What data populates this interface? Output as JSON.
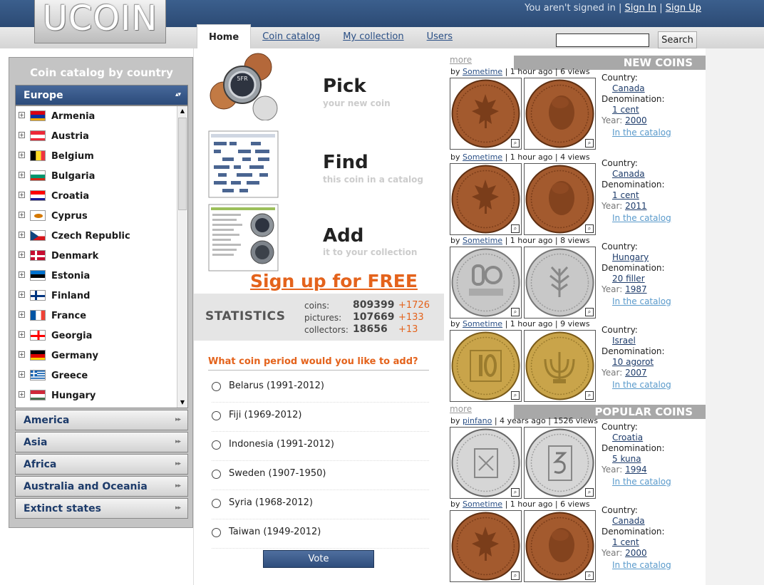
{
  "header": {
    "logo": "UCOIN",
    "auth_text": "You aren't signed in |",
    "sign_in": "Sign In",
    "separator": "|",
    "sign_up": "Sign Up"
  },
  "tabs": [
    {
      "label": "Home",
      "active": true
    },
    {
      "label": "Coin catalog",
      "active": false
    },
    {
      "label": "My collection",
      "active": false
    },
    {
      "label": "Users",
      "active": false
    }
  ],
  "search": {
    "button": "Search",
    "value": ""
  },
  "sidebar": {
    "title": "Coin catalog by country",
    "regions": [
      "Europe",
      "America",
      "Asia",
      "Africa",
      "Australia and Oceania",
      "Extinct states"
    ],
    "countries": [
      "Armenia",
      "Austria",
      "Belgium",
      "Bulgaria",
      "Croatia",
      "Cyprus",
      "Czech Republic",
      "Denmark",
      "Estonia",
      "Finland",
      "France",
      "Georgia",
      "Germany",
      "Greece",
      "Hungary"
    ]
  },
  "features": [
    {
      "title": "Pick",
      "subtitle": "your new coin"
    },
    {
      "title": "Find",
      "subtitle": "this coin in a catalog"
    },
    {
      "title": "Add",
      "subtitle": "it to your collection"
    }
  ],
  "signup": "Sign up for FREE",
  "stats": {
    "title": "STATISTICS",
    "rows": [
      {
        "label": "coins:",
        "value": "809399",
        "inc": "+1726"
      },
      {
        "label": "pictures:",
        "value": "107669",
        "inc": "+133"
      },
      {
        "label": "collectors:",
        "value": "18656",
        "inc": "+13"
      }
    ]
  },
  "poll": {
    "question": "What coin period would you like to add?",
    "options": [
      "Belarus (1991-2012)",
      "Fiji (1969-2012)",
      "Indonesia (1991-2012)",
      "Sweden (1907-1950)",
      "Syria (1968-2012)",
      "Taiwan (1949-2012)"
    ],
    "vote": "Vote"
  },
  "labels": {
    "more": "more",
    "country": "Country:",
    "denomination": "Denomination:",
    "year": "Year:",
    "catalog_link": "In the catalog",
    "by": "by"
  },
  "new_coins": {
    "title": "NEW COINS",
    "items": [
      {
        "user": "Sometime",
        "meta": "| 1 hour ago | 6 views",
        "country": "Canada",
        "denomination": "1 cent",
        "year": "2000"
      },
      {
        "user": "Sometime",
        "meta": "| 1 hour ago | 4 views",
        "country": "Canada",
        "denomination": "1 cent",
        "year": "2011"
      },
      {
        "user": "Sometime",
        "meta": "| 1 hour ago | 8 views",
        "country": "Hungary",
        "denomination": "20 filler",
        "year": "1987"
      },
      {
        "user": "Sometime",
        "meta": "| 1 hour ago | 9 views",
        "country": "Israel",
        "denomination": "10 agorot",
        "year": "2007"
      }
    ]
  },
  "popular_coins": {
    "title": "POPULAR COINS",
    "items": [
      {
        "user": "pinfano",
        "meta": "| 4 years ago | 1526 views",
        "country": "Croatia",
        "denomination": "5 kuna",
        "year": "1994"
      },
      {
        "user": "Sometime",
        "meta": "| 1 hour ago | 6 views",
        "country": "Canada",
        "denomination": "1 cent",
        "year": "2000"
      }
    ]
  },
  "colors": {
    "header": "#2c4a74",
    "accent": "#e4631c",
    "link": "#1d3b6a",
    "copper": "#a35a2e",
    "aluminium": "#c8c8c8",
    "brass": "#c9a44a"
  }
}
